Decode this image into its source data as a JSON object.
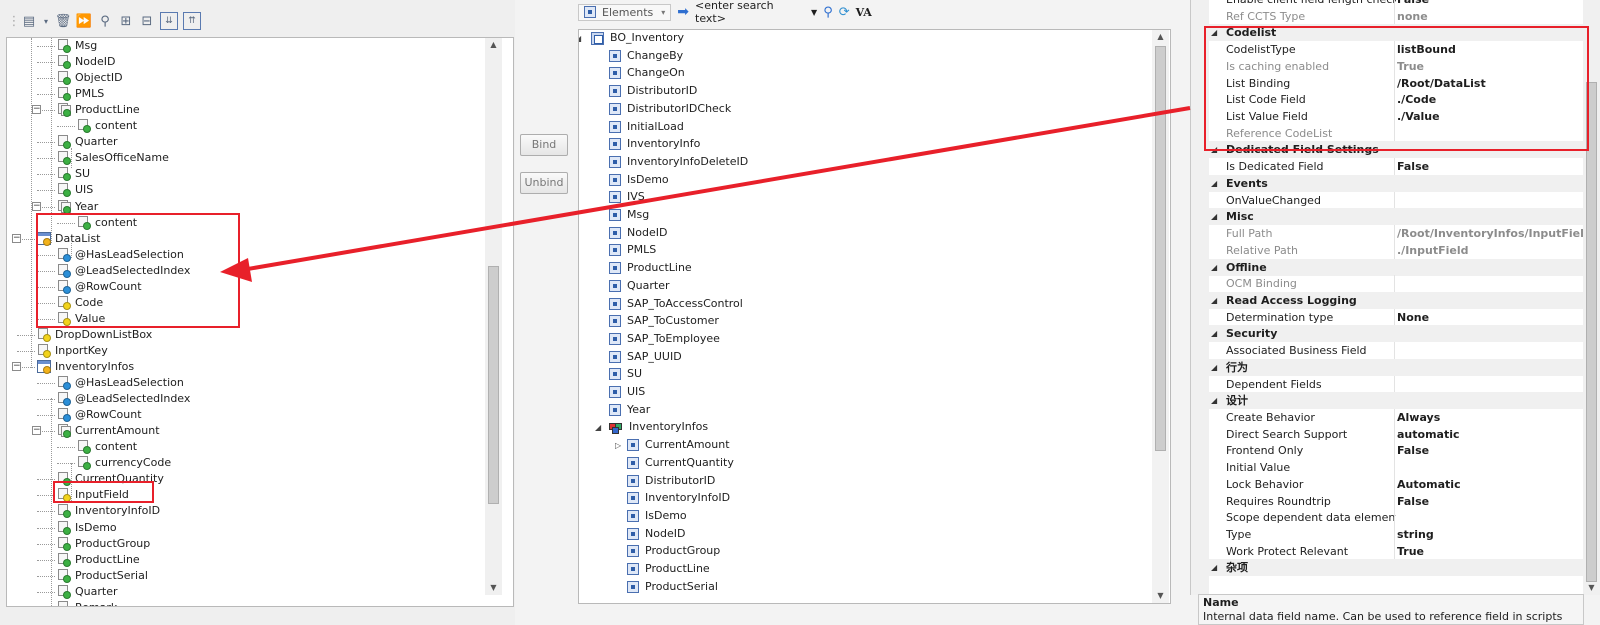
{
  "left": {
    "toolbar_icons": [
      "new-icon",
      "dropdown-arrow-icon",
      "delete-icon",
      "forward-icon",
      "filter-icon",
      "hierarchy-icon",
      "tree-icon",
      "collapse-all-icon",
      "expand-all-icon"
    ],
    "tree": [
      {
        "label": "Msg",
        "icon": "field-green"
      },
      {
        "label": "NodeID",
        "icon": "field-green"
      },
      {
        "label": "ObjectID",
        "icon": "field-green"
      },
      {
        "label": "PMLS",
        "icon": "field-green"
      },
      {
        "label": "ProductLine",
        "icon": "struct-green"
      },
      {
        "label": "content",
        "icon": "field-green"
      },
      {
        "label": "Quarter",
        "icon": "field-green"
      },
      {
        "label": "SalesOfficeName",
        "icon": "field-green"
      },
      {
        "label": "SU",
        "icon": "field-green"
      },
      {
        "label": "UIS",
        "icon": "field-green"
      },
      {
        "label": "Year",
        "icon": "struct-green"
      },
      {
        "label": "content",
        "icon": "field-green"
      },
      {
        "label": "DataList",
        "icon": "list"
      },
      {
        "label": "@HasLeadSelection",
        "icon": "field-blue"
      },
      {
        "label": "@LeadSelectedIndex",
        "icon": "field-blue"
      },
      {
        "label": "@RowCount",
        "icon": "field-blue"
      },
      {
        "label": "Code",
        "icon": "field-yellow"
      },
      {
        "label": "Value",
        "icon": "field-yellow"
      },
      {
        "label": "DropDownListBox",
        "icon": "field-yellow"
      },
      {
        "label": "InportKey",
        "icon": "field-yellow"
      },
      {
        "label": "InventoryInfos",
        "icon": "list"
      },
      {
        "label": "@HasLeadSelection",
        "icon": "field-blue"
      },
      {
        "label": "@LeadSelectedIndex",
        "icon": "field-blue"
      },
      {
        "label": "@RowCount",
        "icon": "field-blue"
      },
      {
        "label": "CurrentAmount",
        "icon": "struct-green"
      },
      {
        "label": "content",
        "icon": "field-green"
      },
      {
        "label": "currencyCode",
        "icon": "field-green"
      },
      {
        "label": "CurrentQuantity",
        "icon": "field-green"
      },
      {
        "label": "InputField",
        "icon": "field-yellow"
      },
      {
        "label": "InventoryInfoID",
        "icon": "field-green"
      },
      {
        "label": "IsDemo",
        "icon": "field-green"
      },
      {
        "label": "ProductGroup",
        "icon": "field-green"
      },
      {
        "label": "ProductLine",
        "icon": "field-green"
      },
      {
        "label": "ProductSerial",
        "icon": "field-green"
      },
      {
        "label": "Quarter",
        "icon": "field-green"
      },
      {
        "label": "Remark",
        "icon": "field-green"
      }
    ]
  },
  "buttons": {
    "bind": "Bind",
    "unbind": "Unbind"
  },
  "middle": {
    "toolbar": {
      "elements_label": "Elements",
      "search_placeholder": "<enter search text>",
      "va_label": "VA"
    },
    "root": "BO_Inventory",
    "items": [
      "ChangeBy",
      "ChangeOn",
      "DistributorID",
      "DistributorIDCheck",
      "InitialLoad",
      "InventoryInfo",
      "InventoryInfoDeleteID",
      "IsDemo",
      "IVS",
      "Msg",
      "NodeID",
      "PMLS",
      "ProductLine",
      "Quarter",
      "SAP_ToAccessControl",
      "SAP_ToCustomer",
      "SAP_ToEmployee",
      "SAP_UUID",
      "SU",
      "UIS",
      "Year"
    ],
    "collection": "InventoryInfos",
    "sub_items": [
      "CurrentAmount",
      "CurrentQuantity",
      "DistributorID",
      "InventoryInfoID",
      "IsDemo",
      "NodeID",
      "ProductGroup",
      "ProductLine",
      "ProductSerial"
    ]
  },
  "properties": {
    "rows": [
      {
        "kind": "prop",
        "name": "Enable client field length check",
        "value": "False",
        "disabled": false
      },
      {
        "kind": "prop",
        "name": "Ref CCTS Type",
        "value": "none",
        "disabled": true
      },
      {
        "kind": "cat",
        "name": "Codelist"
      },
      {
        "kind": "prop",
        "name": "CodelistType",
        "value": "listBound",
        "disabled": false
      },
      {
        "kind": "prop",
        "name": "Is caching enabled",
        "value": "True",
        "disabled": true
      },
      {
        "kind": "prop",
        "name": "List Binding",
        "value": "/Root/DataList",
        "disabled": false
      },
      {
        "kind": "prop",
        "name": "List Code Field",
        "value": "./Code",
        "disabled": false
      },
      {
        "kind": "prop",
        "name": "List Value Field",
        "value": "./Value",
        "disabled": false
      },
      {
        "kind": "prop",
        "name": "Reference CodeList",
        "value": "",
        "disabled": true
      },
      {
        "kind": "cat",
        "name": "Dedicated Field Settings"
      },
      {
        "kind": "prop",
        "name": "Is Dedicated Field",
        "value": "False",
        "disabled": false
      },
      {
        "kind": "cat",
        "name": "Events"
      },
      {
        "kind": "prop",
        "name": "OnValueChanged",
        "value": "",
        "disabled": false
      },
      {
        "kind": "cat",
        "name": "Misc"
      },
      {
        "kind": "prop",
        "name": "Full Path",
        "value": "/Root/InventoryInfos/InputField",
        "disabled": true
      },
      {
        "kind": "prop",
        "name": "Relative Path",
        "value": "./InputField",
        "disabled": true
      },
      {
        "kind": "cat",
        "name": "Offline"
      },
      {
        "kind": "prop",
        "name": "OCM Binding",
        "value": "",
        "disabled": true
      },
      {
        "kind": "cat",
        "name": "Read Access Logging"
      },
      {
        "kind": "prop",
        "name": "Determination type",
        "value": "None",
        "disabled": false
      },
      {
        "kind": "cat",
        "name": "Security"
      },
      {
        "kind": "prop",
        "name": "Associated Business Field",
        "value": "",
        "disabled": false
      },
      {
        "kind": "cat",
        "name": "行为"
      },
      {
        "kind": "prop",
        "name": "Dependent Fields",
        "value": "",
        "disabled": false
      },
      {
        "kind": "cat",
        "name": "设计"
      },
      {
        "kind": "prop",
        "name": "Create Behavior",
        "value": "Always",
        "disabled": false
      },
      {
        "kind": "prop",
        "name": "Direct Search Support",
        "value": "automatic",
        "disabled": false
      },
      {
        "kind": "prop",
        "name": "Frontend Only",
        "value": "False",
        "disabled": false
      },
      {
        "kind": "prop",
        "name": "Initial Value",
        "value": "",
        "disabled": false
      },
      {
        "kind": "prop",
        "name": "Lock Behavior",
        "value": "Automatic",
        "disabled": false
      },
      {
        "kind": "prop",
        "name": "Requires Roundtrip",
        "value": "False",
        "disabled": false
      },
      {
        "kind": "prop",
        "name": "Scope dependent data elements",
        "value": "",
        "disabled": false
      },
      {
        "kind": "prop",
        "name": "Type",
        "value": "string",
        "disabled": false
      },
      {
        "kind": "prop",
        "name": "Work Protect Relevant",
        "value": "True",
        "disabled": false
      },
      {
        "kind": "cat",
        "name": "杂项"
      }
    ],
    "description": {
      "title": "Name",
      "text": "Internal data field name. Can be used to reference field in scripts"
    }
  },
  "colors": {
    "annotation": "#e8202a",
    "green_dot": "#3cb043",
    "blue_dot": "#2b8fd8",
    "yellow_dot": "#f2d31b"
  }
}
